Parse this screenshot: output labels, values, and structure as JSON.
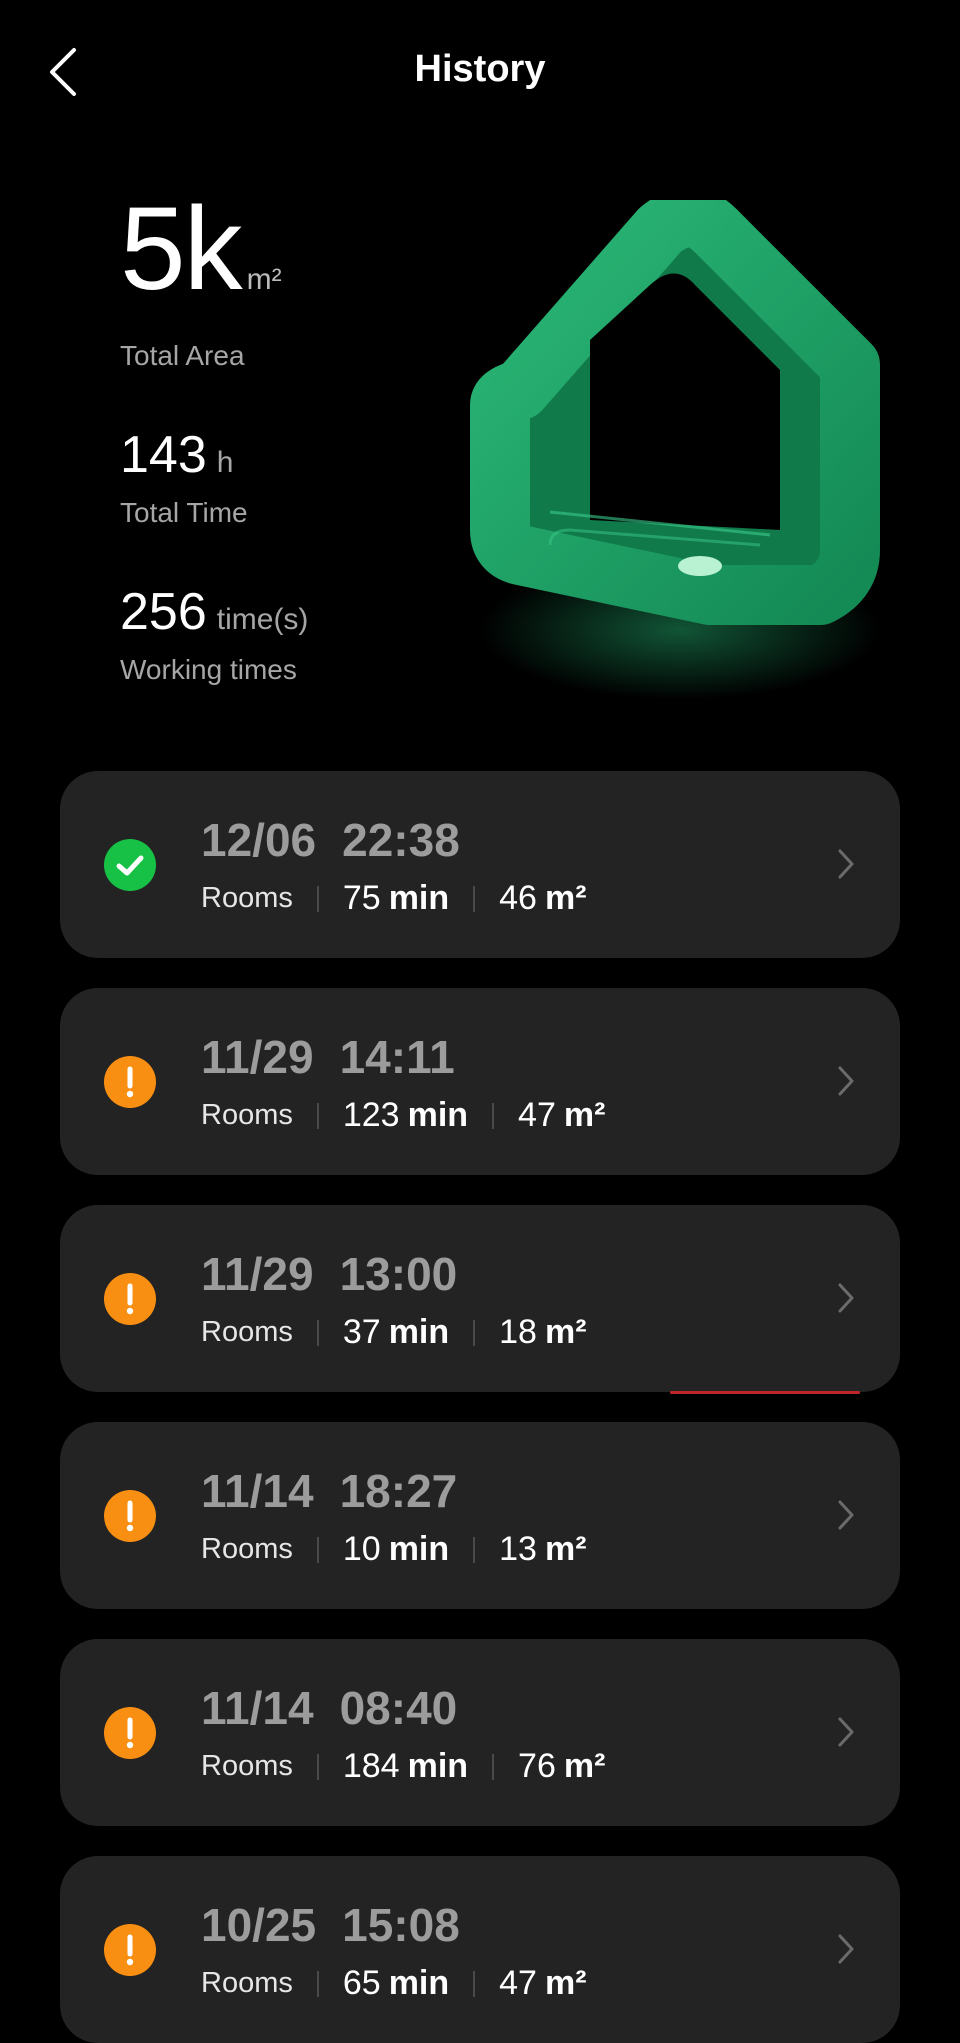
{
  "header": {
    "title": "History"
  },
  "summary": {
    "total_area": {
      "value": "5k",
      "unit": "m²",
      "label": "Total Area"
    },
    "total_time": {
      "value": "143",
      "unit": "h",
      "label": "Total Time"
    },
    "working_times": {
      "value": "256",
      "unit": "time(s)",
      "label": "Working times"
    }
  },
  "records": [
    {
      "status": "completed",
      "date": "12/06",
      "time": "22:38",
      "rooms": "Rooms",
      "duration": "75",
      "duration_unit": "min",
      "area": "46",
      "area_unit": "m²"
    },
    {
      "status": "warning",
      "date": "11/29",
      "time": "14:11",
      "rooms": "Rooms",
      "duration": "123",
      "duration_unit": "min",
      "area": "47",
      "area_unit": "m²"
    },
    {
      "status": "warning",
      "date": "11/29",
      "time": "13:00",
      "rooms": "Rooms",
      "duration": "37",
      "duration_unit": "min",
      "area": "18",
      "area_unit": "m²"
    },
    {
      "status": "warning",
      "date": "11/14",
      "time": "18:27",
      "rooms": "Rooms",
      "duration": "10",
      "duration_unit": "min",
      "area": "13",
      "area_unit": "m²"
    },
    {
      "status": "warning",
      "date": "11/14",
      "time": "08:40",
      "rooms": "Rooms",
      "duration": "184",
      "duration_unit": "min",
      "area": "76",
      "area_unit": "m²"
    },
    {
      "status": "warning",
      "date": "10/25",
      "time": "15:08",
      "rooms": "Rooms",
      "duration": "65",
      "duration_unit": "min",
      "area": "47",
      "area_unit": "m²"
    }
  ],
  "colors": {
    "completed": "#17c146",
    "warning": "#f98f12",
    "card": "#232323",
    "house": "#1f9a62"
  }
}
